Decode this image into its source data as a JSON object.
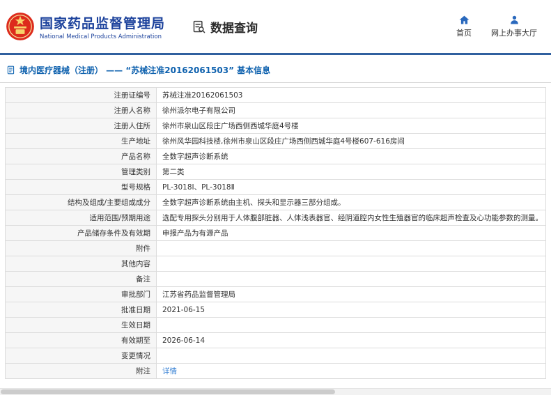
{
  "header": {
    "org_name": "国家药品监督管理局",
    "org_name_en": "National Medical Products Administration",
    "data_query_label": "数据查询",
    "nav": {
      "home_label": "首页",
      "service_hall_label": "网上办事大厅"
    }
  },
  "page": {
    "title": "境内医疗器械（注册） —— “苏械注准20162061503” 基本信息"
  },
  "detail_table": {
    "rows": [
      {
        "label": "注册证编号",
        "value": "苏械注准20162061503"
      },
      {
        "label": "注册人名称",
        "value": "徐州派尔电子有限公司"
      },
      {
        "label": "注册人住所",
        "value": "徐州市泉山区段庄广场西侧西城华庭4号楼"
      },
      {
        "label": "生产地址",
        "value": "徐州风华园科技楼,徐州市泉山区段庄广场西侧西城华庭4号楼607-616房间"
      },
      {
        "label": "产品名称",
        "value": "全数字超声诊断系统"
      },
      {
        "label": "管理类别",
        "value": "第二类"
      },
      {
        "label": "型号规格",
        "value": "PL-3018Ⅰ、PL-3018Ⅱ"
      },
      {
        "label": "结构及组成/主要组成成分",
        "value": "全数字超声诊断系统由主机、探头和显示器三部分组成。"
      },
      {
        "label": "适用范围/预期用途",
        "value": "选配专用探头分别用于人体腹部脏器、人体浅表器官、经阴道腔内女性生殖器官的临床超声检查及心功能参数的测量。"
      },
      {
        "label": "产品储存条件及有效期",
        "value": "申报产品为有源产品"
      },
      {
        "label": "附件",
        "value": ""
      },
      {
        "label": "其他内容",
        "value": ""
      },
      {
        "label": "备注",
        "value": ""
      },
      {
        "label": "审批部门",
        "value": "江苏省药品监督管理局"
      },
      {
        "label": "批准日期",
        "value": "2021-06-15"
      },
      {
        "label": "生效日期",
        "value": ""
      },
      {
        "label": "有效期至",
        "value": "2026-06-14"
      },
      {
        "label": "变更情况",
        "value": ""
      },
      {
        "label": "附注",
        "value": "详情",
        "link": true
      }
    ]
  },
  "colors": {
    "brand_blue": "#1c429c",
    "accent_blue": "#0e61ae",
    "header_rule_blue": "#30609f",
    "link_blue": "#2f7cd3",
    "emblem_red": "#dd2b1c",
    "label_cell_bg": "#f6f6f6",
    "table_border": "#dcdcdc"
  }
}
